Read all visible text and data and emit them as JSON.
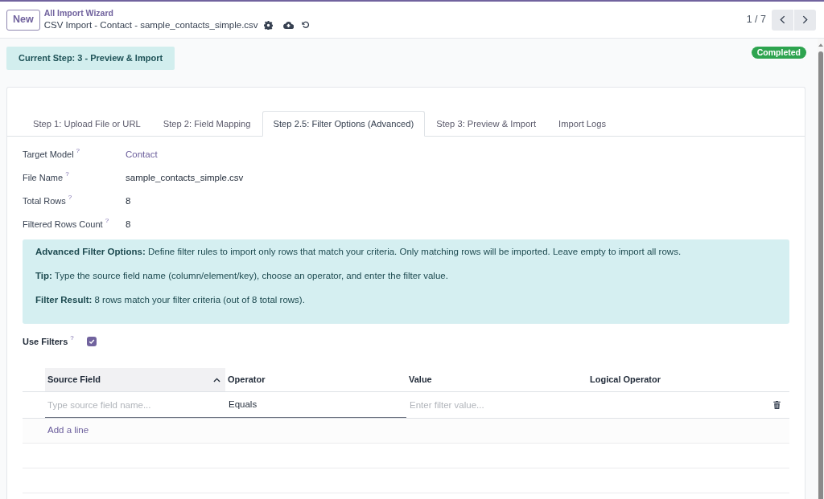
{
  "header": {
    "new_button": "New",
    "breadcrumb": "All Import Wizard",
    "record_title": "CSV Import - Contact - sample_contacts_simple.csv",
    "pager": "1 / 7"
  },
  "current_step": "Current Step: 3 - Preview & Import",
  "status_badge": "Completed",
  "tabs": [
    {
      "label": "Step 1: Upload File or URL",
      "selected": false
    },
    {
      "label": "Step 2: Field Mapping",
      "selected": false
    },
    {
      "label": "Step 2.5: Filter Options (Advanced)",
      "selected": true
    },
    {
      "label": "Step 3: Preview & Import",
      "selected": false
    },
    {
      "label": "Import Logs",
      "selected": false
    }
  ],
  "fields": [
    {
      "label": "Target Model",
      "help": "?",
      "value": "Contact",
      "kind": "link"
    },
    {
      "label": "File Name",
      "help": "?",
      "value": "sample_contacts_simple.csv",
      "kind": "text"
    },
    {
      "label": "Total Rows",
      "help": "?",
      "value": "8",
      "kind": "text"
    },
    {
      "label": "Filtered Rows Count",
      "help": "?",
      "value": "8",
      "kind": "text"
    }
  ],
  "alert": [
    "**Advanced Filter Options:** Define filter rules to import only rows that match your criteria. Only matching rows will be imported. Leave empty to import all rows.",
    "**Tip:** Type the source field name (column/element/key), choose an operator, and enter the filter value.",
    "**Filter Result:** 8 rows match your filter criteria (out of 8 total rows)."
  ],
  "use_filters": {
    "label": "Use Filters",
    "help": "?",
    "checked": true
  },
  "filter_table": {
    "columns": [
      {
        "label": "Source Field",
        "sorted": true
      },
      {
        "label": "Operator",
        "sorted": false
      },
      {
        "label": "Value",
        "sorted": false
      },
      {
        "label": "Logical Operator",
        "sorted": false
      }
    ],
    "rows": [
      {
        "source_field": {
          "placeholder": "Type source field name..."
        },
        "operator": "Equals",
        "value": {
          "placeholder": "Enter filter value..."
        }
      }
    ],
    "add_line": "Add a line"
  }
}
